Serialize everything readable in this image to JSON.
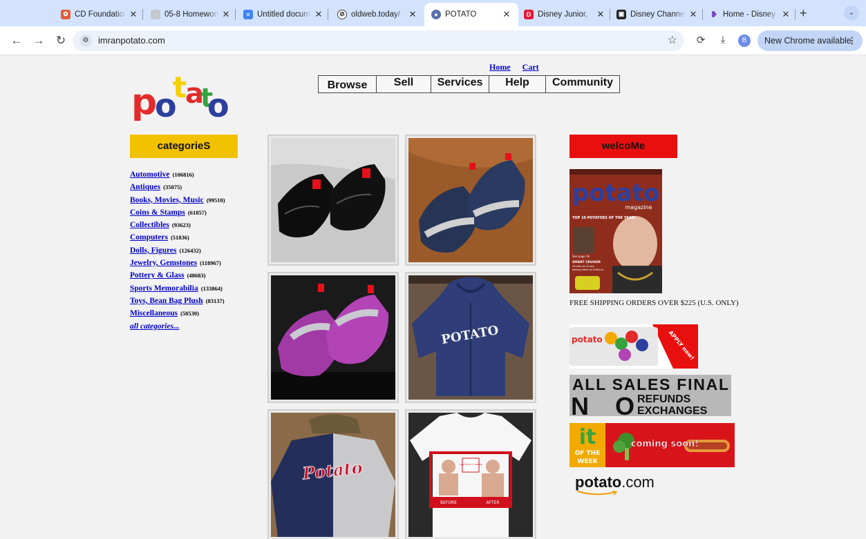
{
  "browser": {
    "tabs": [
      {
        "title": "CD Foundation",
        "color": "#e35b3a",
        "glyph": "✿"
      },
      {
        "title": "05-8 Homework",
        "color": "#9aa0a6",
        "glyph": "◌"
      },
      {
        "title": "Untitled document",
        "color": "#4285f4",
        "glyph": "≡"
      },
      {
        "title": "oldweb.today/",
        "color": "#ffffff",
        "glyph": "⊘"
      },
      {
        "title": "POTATO",
        "color": "#5b6fb0",
        "glyph": "●"
      },
      {
        "title": "Disney Junior,",
        "color": "#e31937",
        "glyph": "D"
      },
      {
        "title": "Disney Channel",
        "color": "#222222",
        "glyph": "▣"
      },
      {
        "title": "Home - Disney",
        "color": "#7a44c9",
        "glyph": "❥"
      }
    ],
    "new_tab_glyph": "+",
    "tab_menu_glyph": "⌄",
    "address": "imranpotato.com",
    "profile_initial": "B",
    "update_label": "New Chrome available"
  },
  "site": {
    "top_links": [
      "Home",
      "Cart"
    ],
    "nav": [
      "Browse",
      "Sell",
      "Services",
      "Help",
      "Community"
    ],
    "logo_letters": [
      "p",
      "o",
      "t",
      "a",
      "t",
      "o"
    ],
    "categories_header": "categorieS",
    "categories": [
      {
        "name": "Automotive",
        "count": "(106816)"
      },
      {
        "name": "Antiques",
        "count": "(35075)"
      },
      {
        "name": "Books, Movies, Music",
        "count": "(99510)"
      },
      {
        "name": "Coins & Stamps",
        "count": "(61857)"
      },
      {
        "name": "Collectibles",
        "count": "(93623)"
      },
      {
        "name": "Computers",
        "count": "(51836)"
      },
      {
        "name": "Dolls, Figures",
        "count": "(126432)"
      },
      {
        "name": "Jewelry, Gemstones",
        "count": "(118967)"
      },
      {
        "name": "Pottery & Glass",
        "count": "(48683)"
      },
      {
        "name": "Sports Memorabilia",
        "count": "(133864)"
      },
      {
        "name": "Toys, Bean Bag Plush",
        "count": "(83137)"
      },
      {
        "name": "Miscellaneous",
        "count": "(58530)"
      }
    ],
    "all_categories": "all categories...",
    "products": [
      {
        "name": "black-patent-sneakers"
      },
      {
        "name": "navy-grey-sneakers"
      },
      {
        "name": "purple-silver-sneakers"
      },
      {
        "name": "navy-potato-hoodie",
        "print": "POTATO"
      },
      {
        "name": "color-block-hoodie",
        "print": "Potato"
      },
      {
        "name": "white-graphic-tee",
        "print": "i got fat in 2 weeks",
        "captions": [
          "BEFORE",
          "AFTER"
        ]
      }
    ],
    "welcome_header": "welcoMe",
    "magazine": {
      "brand": "potato",
      "subtitle": "magazine",
      "cover_lines": [
        "TOP 10 POTATOES OF THE YEAR!",
        "See page 16",
        "SMART CRUISER",
        "16 refer to 10 see",
        "leasing starts at $189/mo"
      ]
    },
    "shipping_text": "FREE SHIPPING ORDERS OVER $225 (U.S. ONLY)",
    "card_ad": {
      "brand": "potato",
      "tag": "APPLY now!"
    },
    "sales_final": {
      "line1": "ALL SALES FINAL",
      "big": "NO",
      "line2": "REFUNDS",
      "line3": "EXCHANGES"
    },
    "it_week": {
      "big": "it",
      "small1": "OF THE",
      "small2": "WEEK",
      "tag": "coming soon!"
    },
    "footer_logo": {
      "word": "potato",
      "tld": ".com"
    },
    "colors": {
      "categories_header": "#f2c200",
      "welcome_header": "#e8100f",
      "link": "#0000cc",
      "logo_p": "#e32b2b",
      "logo_o": "#2d3f9e",
      "logo_t": "#f7d000",
      "logo_a": "#e32b2b",
      "logo_t2": "#36a341",
      "logo_o2": "#2d3f9e"
    }
  }
}
